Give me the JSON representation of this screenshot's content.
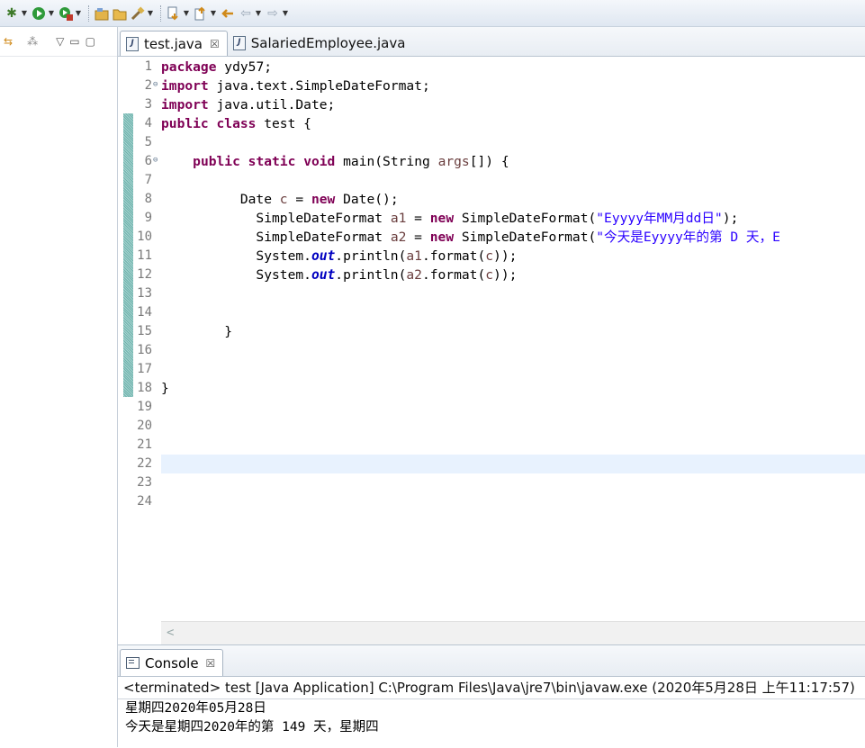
{
  "toolbar": {
    "icons": [
      "debug-icon",
      "run-icon",
      "external-tools-icon",
      "new-java-project-icon",
      "open-folder-icon",
      "build-icon",
      "next-annotation-icon",
      "prev-annotation-icon",
      "last-edit-icon",
      "back-icon",
      "forward-icon"
    ]
  },
  "left_pane": {
    "icons": [
      "link-editor-icon",
      "filter-icon",
      "view-menu-icon",
      "minimize-icon",
      "maximize-icon"
    ]
  },
  "editor": {
    "tabs": [
      {
        "label": "test.java",
        "active": true,
        "close": "☒"
      },
      {
        "label": "SalariedEmployee.java",
        "active": false
      }
    ],
    "current_line": 22,
    "lines": [
      {
        "n": "1",
        "parts": [
          [
            "kw",
            "package"
          ],
          [
            "txt",
            " ydy57;"
          ]
        ]
      },
      {
        "n": "2",
        "fold": true,
        "parts": [
          [
            "kw",
            "import"
          ],
          [
            "txt",
            " java.text.SimpleDateFormat;"
          ]
        ]
      },
      {
        "n": "3",
        "parts": [
          [
            "kw",
            "import"
          ],
          [
            "txt",
            " java.util.Date;"
          ]
        ]
      },
      {
        "n": "4",
        "parts": [
          [
            "kw",
            "public"
          ],
          [
            "txt",
            " "
          ],
          [
            "kw",
            "class"
          ],
          [
            "txt",
            " test {"
          ]
        ]
      },
      {
        "n": "5",
        "parts": []
      },
      {
        "n": "6",
        "fold": true,
        "parts": [
          [
            "txt",
            "    "
          ],
          [
            "kw",
            "public"
          ],
          [
            "txt",
            " "
          ],
          [
            "kw",
            "static"
          ],
          [
            "txt",
            " "
          ],
          [
            "kw",
            "void"
          ],
          [
            "txt",
            " main(String "
          ],
          [
            "var",
            "args"
          ],
          [
            "txt",
            "[]) {"
          ]
        ]
      },
      {
        "n": "7",
        "parts": []
      },
      {
        "n": "8",
        "parts": [
          [
            "txt",
            "          Date "
          ],
          [
            "var",
            "c"
          ],
          [
            "txt",
            " = "
          ],
          [
            "kw",
            "new"
          ],
          [
            "txt",
            " Date();"
          ]
        ]
      },
      {
        "n": "9",
        "parts": [
          [
            "txt",
            "            SimpleDateFormat "
          ],
          [
            "var",
            "a1"
          ],
          [
            "txt",
            " = "
          ],
          [
            "kw",
            "new"
          ],
          [
            "txt",
            " SimpleDateFormat("
          ],
          [
            "str",
            "\"Eyyyy年MM月dd日\""
          ],
          [
            "txt",
            ");"
          ]
        ]
      },
      {
        "n": "10",
        "parts": [
          [
            "txt",
            "            SimpleDateFormat "
          ],
          [
            "var",
            "a2"
          ],
          [
            "txt",
            " = "
          ],
          [
            "kw",
            "new"
          ],
          [
            "txt",
            " SimpleDateFormat("
          ],
          [
            "str",
            "\"今天是Eyyyy年的第 D 天，E"
          ]
        ]
      },
      {
        "n": "11",
        "parts": [
          [
            "txt",
            "            System."
          ],
          [
            "fld",
            "out"
          ],
          [
            "txt",
            ".println("
          ],
          [
            "var",
            "a1"
          ],
          [
            "txt",
            ".format("
          ],
          [
            "var",
            "c"
          ],
          [
            "txt",
            "));"
          ]
        ]
      },
      {
        "n": "12",
        "parts": [
          [
            "txt",
            "            System."
          ],
          [
            "fld",
            "out"
          ],
          [
            "txt",
            ".println("
          ],
          [
            "var",
            "a2"
          ],
          [
            "txt",
            ".format("
          ],
          [
            "var",
            "c"
          ],
          [
            "txt",
            "));"
          ]
        ]
      },
      {
        "n": "13",
        "parts": []
      },
      {
        "n": "14",
        "parts": []
      },
      {
        "n": "15",
        "parts": [
          [
            "txt",
            "        }"
          ]
        ]
      },
      {
        "n": "16",
        "parts": []
      },
      {
        "n": "17",
        "parts": []
      },
      {
        "n": "18",
        "parts": [
          [
            "txt",
            "}"
          ]
        ]
      },
      {
        "n": "19",
        "parts": []
      },
      {
        "n": "20",
        "parts": []
      },
      {
        "n": "21",
        "parts": []
      },
      {
        "n": "22",
        "parts": []
      },
      {
        "n": "23",
        "parts": []
      },
      {
        "n": "24",
        "parts": []
      }
    ],
    "scroll_left_glyph": "<"
  },
  "console": {
    "tab_label": "Console",
    "tab_close": "☒",
    "status": "<terminated> test [Java Application] C:\\Program Files\\Java\\jre7\\bin\\javaw.exe (2020年5月28日 上午11:17:57)",
    "output": [
      "星期四2020年05月28日",
      "今天是星期四2020年的第 149 天，星期四"
    ]
  }
}
